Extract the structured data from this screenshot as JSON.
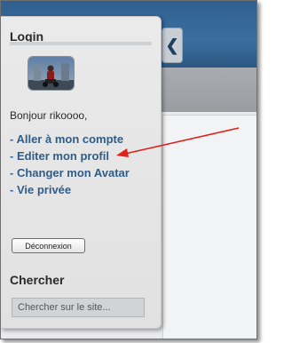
{
  "login": {
    "title": "Login",
    "greeting": "Bonjour rikoooo,",
    "links": [
      {
        "dash": "- ",
        "label": "Aller à mon compte"
      },
      {
        "dash": "- ",
        "label": "Editer mon profil"
      },
      {
        "dash": "- ",
        "label": "Changer mon Avatar"
      },
      {
        "dash": "- ",
        "label": "Vie privée"
      }
    ],
    "logout_label": "Déconnexion"
  },
  "search": {
    "title": "Chercher",
    "placeholder": "Chercher sur le site..."
  },
  "collapse_icon": "chevron-left-icon",
  "colors": {
    "link": "#2e5d8a",
    "annotation_arrow": "#e0201c",
    "header": "#3b6f9f"
  }
}
